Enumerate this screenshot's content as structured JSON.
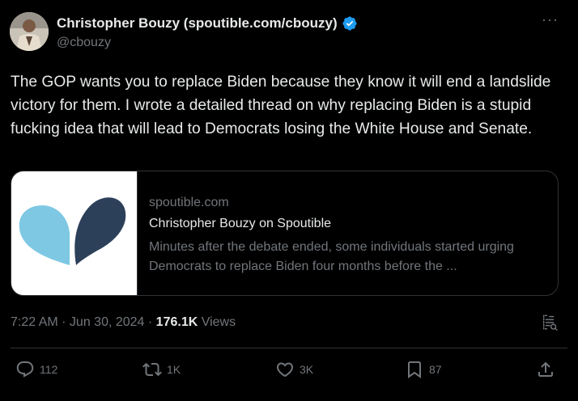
{
  "author": {
    "name": "Christopher Bouzy (spoutible.com/cbouzy)",
    "handle": "@cbouzy",
    "verified_color": "#1d9bf0"
  },
  "more_label": "···",
  "tweet": {
    "text": "The GOP wants you to replace Biden because they know it will end a landslide victory for them. I wrote a detailed thread on why replacing Biden is a stupid fucking idea that will lead to Democrats losing the White House and Senate."
  },
  "card": {
    "domain": "spoutible.com",
    "title": "Christopher Bouzy on Spoutible",
    "description": "Minutes after the debate ended, some individuals started urging Democrats to replace Biden four months before the ...",
    "logo_colors": [
      "#7ec8e3",
      "#2d4059"
    ]
  },
  "meta": {
    "time": "7:22 AM",
    "separator": " · ",
    "date": "Jun 30, 2024",
    "views_count": "176.1K",
    "views_label": "Views"
  },
  "actions": {
    "reply_count": "112",
    "repost_count": "1K",
    "like_count": "3K",
    "bookmark_count": "87"
  },
  "icons": [
    "verified-badge-icon",
    "more-icon",
    "grok-icon",
    "reply-icon",
    "repost-icon",
    "like-icon",
    "bookmark-icon",
    "share-icon"
  ]
}
